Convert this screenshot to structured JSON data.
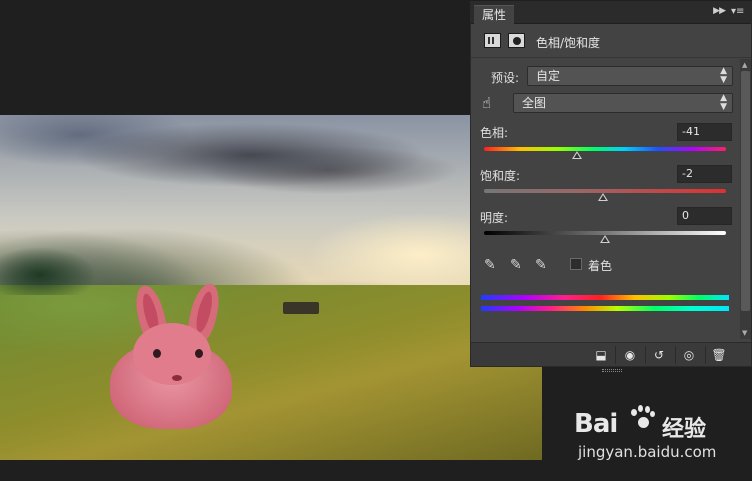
{
  "panel": {
    "tab_label": "属性",
    "title": "色相/饱和度",
    "preset_label": "预设:",
    "preset_value": "自定",
    "channel_value": "全图",
    "hue": {
      "label": "色相:",
      "value": "-41",
      "level": 0.385
    },
    "saturation": {
      "label": "饱和度:",
      "value": "-2",
      "level": 0.49
    },
    "lightness": {
      "label": "明度:",
      "value": "0",
      "level": 0.5
    },
    "colorize_label": "着色",
    "colorize_checked": false
  },
  "icons": {
    "panel_menu": "panel-menu-icon",
    "hand": "targeted-adjustment-hand-icon",
    "eyedroppers": [
      "eyedropper-icon",
      "eyedropper-plus-icon",
      "eyedropper-minus-icon"
    ],
    "footer": [
      "clip-to-layer-icon",
      "view-previous-state-icon",
      "reset-icon",
      "visibility-eye-icon",
      "delete-trash-icon"
    ]
  },
  "watermark": {
    "logo_latin": "Bai",
    "logo_cn": "经验",
    "url": "jingyan.baidu.com"
  },
  "colors": {
    "panel_bg": "#434343",
    "app_bg": "#1f1f1f",
    "rabbit_tint": "#e07c8c"
  }
}
